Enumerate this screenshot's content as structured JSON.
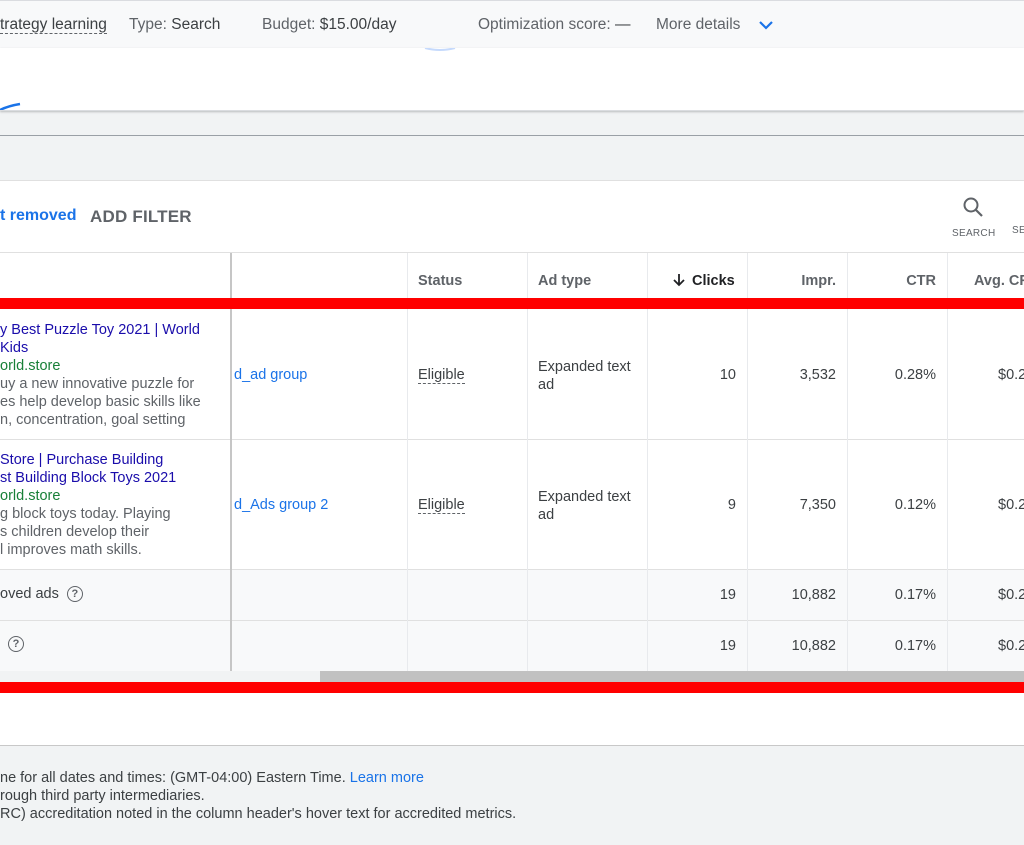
{
  "summary": {
    "bid_strategy": "trategy learning",
    "type_label": "Type:",
    "type_value": "Search",
    "budget_label": "Budget:",
    "budget_value": "$15.00/day",
    "opt_label": "Optimization score:",
    "opt_value": "—",
    "more_details": "More details"
  },
  "filters": {
    "active_chip": "t removed",
    "add_filter": "ADD FILTER",
    "tools": [
      {
        "icon": "search-icon",
        "label": "SEARCH"
      },
      {
        "icon": "segment-icon",
        "label": "SE"
      }
    ]
  },
  "table": {
    "columns": {
      "status": "Status",
      "ad_type": "Ad type",
      "clicks": "Clicks",
      "impr": "Impr.",
      "ctr": "CTR",
      "avg_cpc": "Avg. CF"
    },
    "rows": [
      {
        "title1": "y Best Puzzle Toy 2021 | World",
        "title2": "Kids",
        "url": "orld.store",
        "desc1": "uy a new innovative puzzle for",
        "desc2": "es help develop basic skills like",
        "desc3": "n, concentration, goal setting",
        "ad_group": "d_ad group",
        "status": "Eligible",
        "ad_type1": "Expanded text",
        "ad_type2": "ad",
        "clicks": "10",
        "impr": "3,532",
        "ctr": "0.28%",
        "avg_cpc": "$0.2"
      },
      {
        "title1": "Store | Purchase Building",
        "title2": "st Building Block Toys 2021",
        "url": "orld.store",
        "desc1": "g block toys today. Playing",
        "desc2": "s children develop their",
        "desc3": "l improves math skills.",
        "ad_group": "d_Ads group 2",
        "status": "Eligible",
        "ad_type1": "Expanded text",
        "ad_type2": "ad",
        "clicks": "9",
        "impr": "7,350",
        "ctr": "0.12%",
        "avg_cpc": "$0.2"
      }
    ],
    "totals": [
      {
        "label": "oved ads",
        "clicks": "19",
        "impr": "10,882",
        "ctr": "0.17%",
        "avg_cpc": "$0.2"
      },
      {
        "label": "",
        "clicks": "19",
        "impr": "10,882",
        "ctr": "0.17%",
        "avg_cpc": "$0.2"
      }
    ]
  },
  "footer": {
    "line1": "ne for all dates and times: (GMT-04:00) Eastern Time.",
    "learn_more": "Learn more",
    "line2": "rough third party intermediaries.",
    "line3": "RC) accreditation noted in the column header's hover text for accredited metrics."
  },
  "colors": {
    "accent": "#1a73e8",
    "ad_title": "#1a0dab",
    "ad_url": "#188038",
    "highlight": "#ff0000"
  }
}
